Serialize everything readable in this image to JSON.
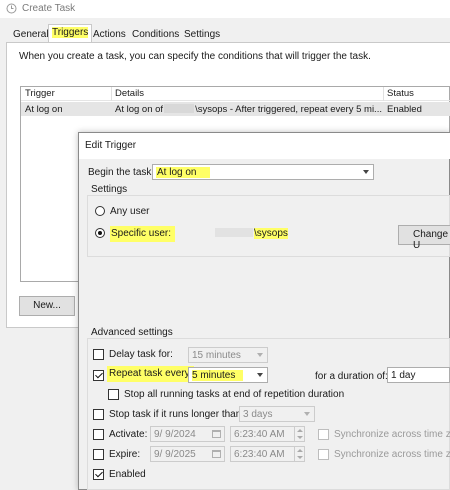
{
  "window": {
    "title": "Create Task"
  },
  "tabs": [
    {
      "label": "General"
    },
    {
      "label": "Triggers"
    },
    {
      "label": "Actions"
    },
    {
      "label": "Conditions"
    },
    {
      "label": "Settings"
    }
  ],
  "triggers": {
    "intro": "When you create a task, you can specify the conditions that will trigger the task.",
    "columns": [
      "Trigger",
      "Details",
      "Status"
    ],
    "rows": [
      {
        "trigger": "At log on",
        "details_prefix": "At log on of",
        "details_suffix": "\\sysops - After triggered, repeat every 5 mi...",
        "status": "Enabled"
      }
    ],
    "new_button": "New..."
  },
  "dialog": {
    "title": "Edit Trigger",
    "begin_label": "Begin the task:",
    "begin_value": "At log on",
    "settings_label": "Settings",
    "any_user": "Any user",
    "specific_user": "Specific user:",
    "user_suffix": "\\sysops",
    "change_user": "Change U",
    "advanced_label": "Advanced settings",
    "delay_label": "Delay task for:",
    "delay_value": "15 minutes",
    "repeat_label": "Repeat task every:",
    "repeat_value": "5 minutes",
    "duration_label": "for a duration of:",
    "duration_value": "1 day",
    "stop_all_label": "Stop all running tasks at end of repetition duration",
    "stop_longer_label": "Stop task if it runs longer than:",
    "stop_longer_value": "3 days",
    "activate_label": "Activate:",
    "activate_date": "9/  9/2024",
    "activate_time": "6:23:40 AM",
    "expire_label": "Expire:",
    "expire_date": "9/  9/2025",
    "expire_time": "6:23:40 AM",
    "sync_label": "Synchronize across time zone",
    "enabled_label": "Enabled"
  },
  "colors": {
    "highlight": "#ffff66",
    "selected_row": "#e5e5e5"
  }
}
